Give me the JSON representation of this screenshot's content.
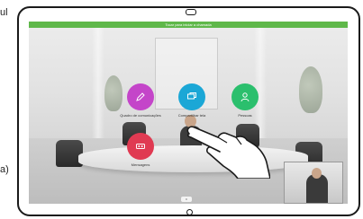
{
  "page": {
    "side_text_top": "ul",
    "side_text_bottom": "a)"
  },
  "screen": {
    "banner_text": "Tocar para iniciar a chamada",
    "bottom_button_label": "Ir"
  },
  "actions": [
    {
      "label": "Quadro de comunicações",
      "icon": "pen-icon",
      "color": "#c445c9"
    },
    {
      "label": "Compartilhar tela",
      "icon": "screen-share-icon",
      "color": "#1ba7d6"
    },
    {
      "label": "Pessoas",
      "icon": "person-icon",
      "color": "#2bbf6d"
    },
    {
      "label": "Mensagens",
      "icon": "voicemail-icon",
      "color": "#e03a52"
    }
  ]
}
